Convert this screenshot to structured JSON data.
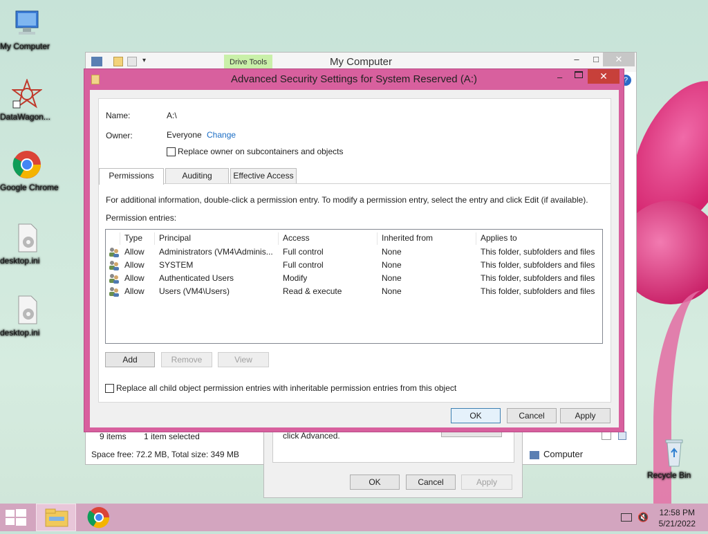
{
  "desktop": {
    "icons": [
      {
        "label": "My Computer",
        "icon": "monitor-icon"
      },
      {
        "label": "DataWagon...",
        "icon": "datawagon-icon"
      },
      {
        "label": "Google Chrome",
        "icon": "chrome-icon"
      },
      {
        "label": "desktop.ini",
        "icon": "settings-file-icon"
      },
      {
        "label": "desktop.ini",
        "icon": "settings-file-icon"
      },
      {
        "label": "Recycle Bin",
        "icon": "recycle-bin-icon"
      }
    ]
  },
  "explorer": {
    "title": "My Computer",
    "contextual_tab": "Drive Tools",
    "status_items": "9 items",
    "status_selected": "1 item selected",
    "space_info": "Space free: 72.2 MB, Total size: 349 MB",
    "details_label": "Computer"
  },
  "properties_dialog": {
    "text": "click Advanced.",
    "ok": "OK",
    "cancel": "Cancel",
    "apply": "Apply"
  },
  "dialog": {
    "title": "Advanced Security Settings for System Reserved (A:)",
    "name_label": "Name:",
    "name_value": "A:\\",
    "owner_label": "Owner:",
    "owner_value": "Everyone",
    "change_link": "Change",
    "replace_owner_label": "Replace owner on subcontainers and objects",
    "tabs": [
      "Permissions",
      "Auditing",
      "Effective Access"
    ],
    "info_text": "For additional information, double-click a permission entry. To modify a permission entry, select the entry and click Edit (if available).",
    "entries_label": "Permission entries:",
    "columns": [
      "Type",
      "Principal",
      "Access",
      "Inherited from",
      "Applies to"
    ],
    "rows": [
      [
        "Allow",
        "Administrators (VM4\\Adminis...",
        "Full control",
        "None",
        "This folder, subfolders and files"
      ],
      [
        "Allow",
        "SYSTEM",
        "Full control",
        "None",
        "This folder, subfolders and files"
      ],
      [
        "Allow",
        "Authenticated Users",
        "Modify",
        "None",
        "This folder, subfolders and files"
      ],
      [
        "Allow",
        "Users (VM4\\Users)",
        "Read & execute",
        "None",
        "This folder, subfolders and files"
      ]
    ],
    "add": "Add",
    "remove": "Remove",
    "view": "View",
    "replace_child_label": "Replace all child object permission entries with inheritable permission entries from this object",
    "ok": "OK",
    "cancel": "Cancel",
    "apply": "Apply"
  },
  "taskbar": {
    "time": "12:58 PM",
    "date": "5/21/2022"
  }
}
